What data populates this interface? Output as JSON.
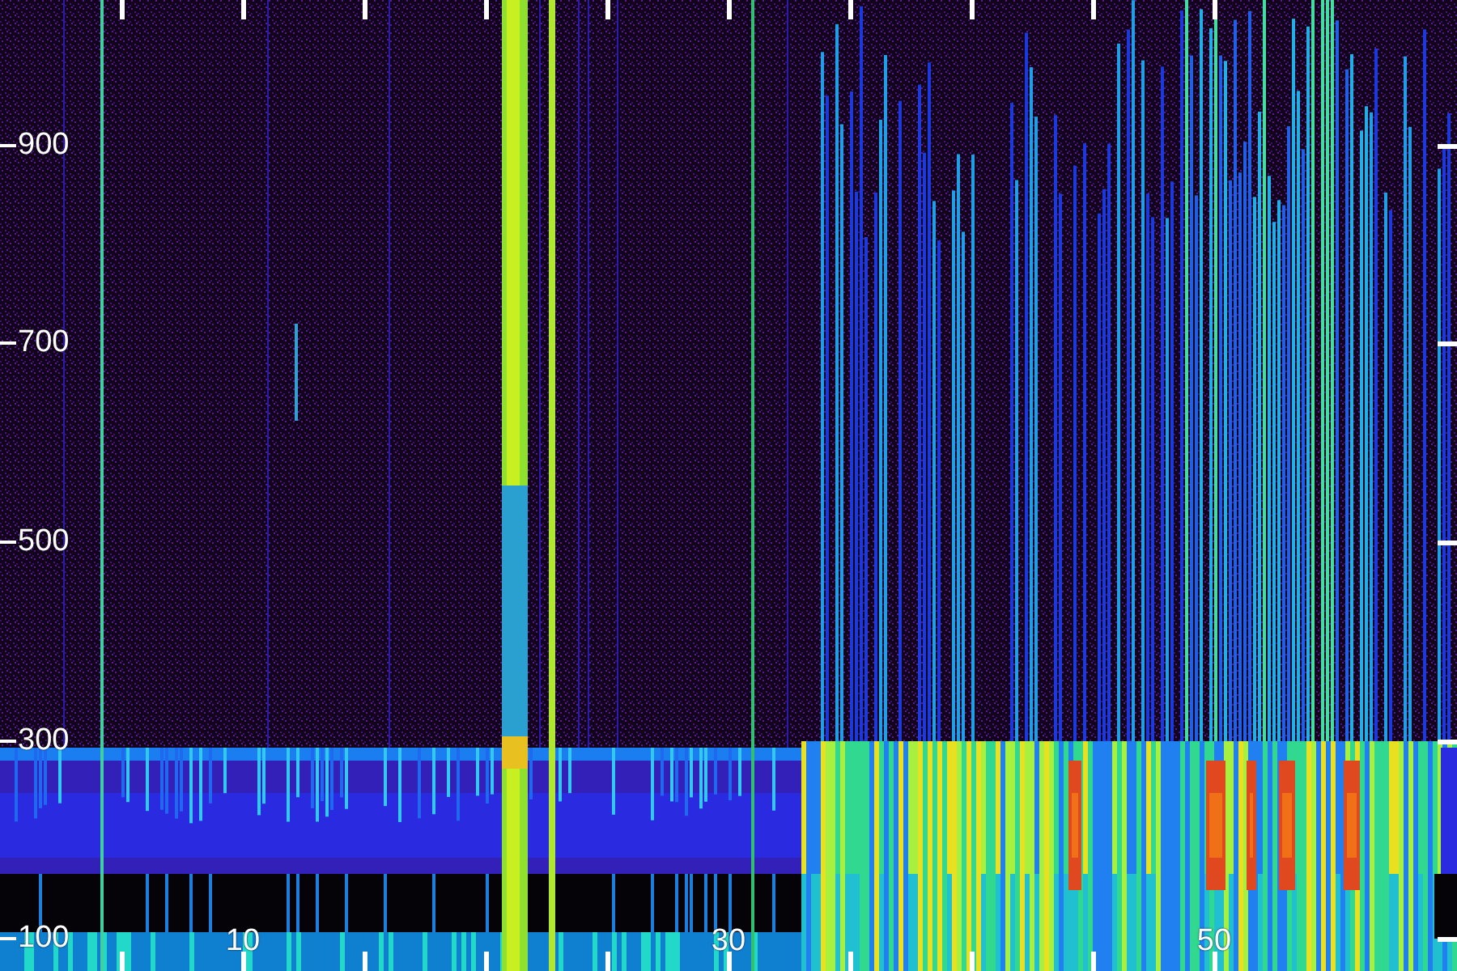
{
  "plot": {
    "y_axis": {
      "tick_labels": [
        "900",
        "700",
        "500",
        "300",
        "100"
      ]
    },
    "x_axis": {
      "tick_labels": [
        "10",
        "30",
        "50"
      ]
    }
  }
}
